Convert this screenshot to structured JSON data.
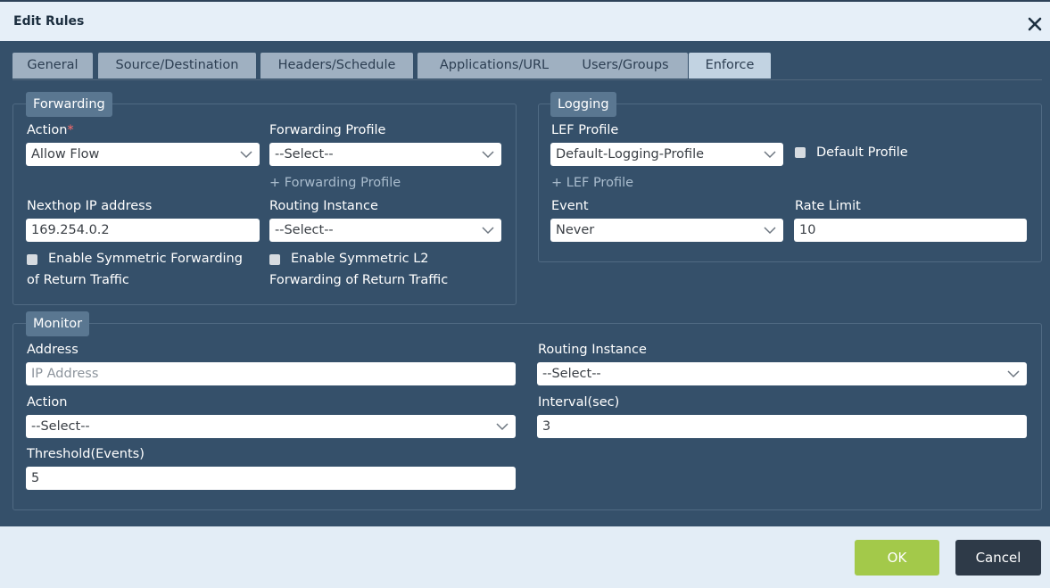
{
  "window": {
    "title": "Edit Rules"
  },
  "tabs": [
    {
      "label": "General"
    },
    {
      "label": "Source/Destination"
    },
    {
      "label": "Headers/Schedule"
    },
    {
      "label": "Applications/URL"
    },
    {
      "label": "Users/Groups"
    },
    {
      "label": "Enforce",
      "active": true
    }
  ],
  "forwarding": {
    "legend": "Forwarding",
    "action_label": "Action",
    "action_required": "*",
    "action_value": "Allow Flow",
    "profile_label": "Forwarding Profile",
    "profile_value": "--Select--",
    "add_profile_link": "+ Forwarding Profile",
    "nexthop_label": "Nexthop IP address",
    "nexthop_value": "169.254.0.2",
    "routing_label": "Routing Instance",
    "routing_value": "--Select--",
    "sym_fwd_line1": "Enable Symmetric Forwarding",
    "sym_fwd_line2": "of Return Traffic",
    "sym_l2_line1": "Enable Symmetric L2",
    "sym_l2_line2": "Forwarding of Return Traffic"
  },
  "logging": {
    "legend": "Logging",
    "lef_label": "LEF Profile",
    "lef_value": "Default-Logging-Profile",
    "default_profile_label": "Default Profile",
    "add_lef_link": "+ LEF Profile",
    "event_label": "Event",
    "event_value": "Never",
    "rate_label": "Rate Limit",
    "rate_value": "10"
  },
  "monitor": {
    "legend": "Monitor",
    "address_label": "Address",
    "address_placeholder": "IP Address",
    "routing_label": "Routing Instance",
    "routing_value": "--Select--",
    "action_label": "Action",
    "action_value": "--Select--",
    "interval_label": "Interval(sec)",
    "interval_value": "3",
    "threshold_label": "Threshold(Events)",
    "threshold_value": "5"
  },
  "footer": {
    "ok_label": "OK",
    "cancel_label": "Cancel"
  },
  "colors": {
    "ok_button": "#a3c94a",
    "cancel_button": "#2e3a48",
    "panel_bg": "#35506a"
  }
}
